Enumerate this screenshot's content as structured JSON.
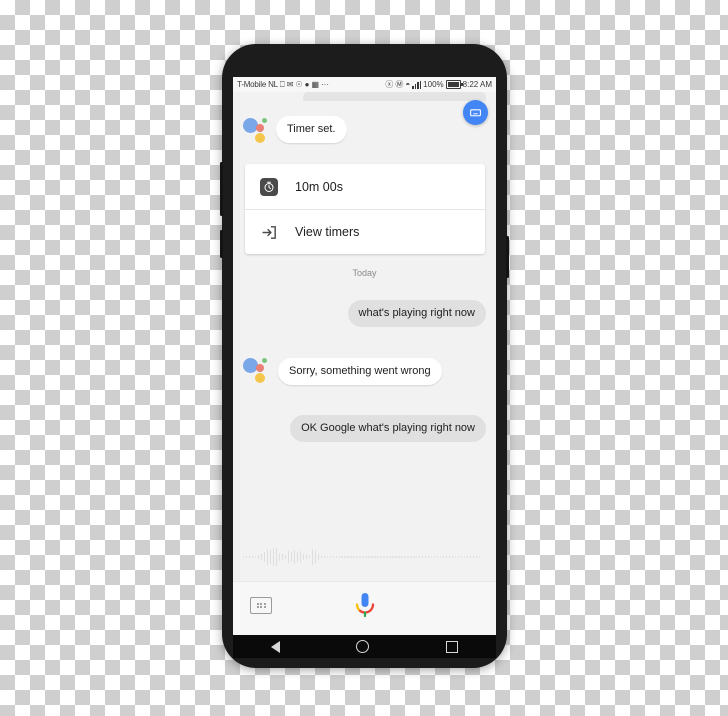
{
  "device": {
    "name": "android-smartphone",
    "frame_color": "#1c1c1c"
  },
  "status_bar": {
    "carrier": "T-Mobile",
    "network": "NL",
    "icons_left": [
      "cast-icon",
      "mail-icon",
      "whatsapp-icon",
      "chat-icon",
      "app-icon",
      "more-overflow-icon"
    ],
    "overflow": "···",
    "icons_right": [
      "location-icon",
      "nfc-icon",
      "wifi-icon",
      "signal-icon"
    ],
    "location_glyph": "ⓧ",
    "nfc_glyph": "N",
    "wifi_glyph": "◠",
    "battery_percent": "100%",
    "time": "8:22 AM"
  },
  "assistant": {
    "keyboard_fab": "keyboard-fab",
    "logo": "google-assistant-dots",
    "reply": "Timer set.",
    "timer_card": {
      "rows": [
        {
          "icon": "clock-icon",
          "label": "10m 00s"
        },
        {
          "icon": "open-timers-icon",
          "label": "View timers"
        }
      ]
    },
    "day_separator": "Today",
    "messages": [
      {
        "from": "user",
        "text": "what's playing right now"
      },
      {
        "from": "assistant",
        "text": "Sorry, something went wrong"
      },
      {
        "from": "user",
        "text": "OK Google what's playing right now"
      }
    ],
    "waveform": {
      "name": "audio-waveform",
      "color": "#dedede",
      "levels": [
        1,
        1,
        1,
        2,
        2,
        3,
        5,
        8,
        12,
        11,
        14,
        13,
        6,
        4,
        3,
        9,
        8,
        10,
        7,
        9,
        5,
        3,
        2,
        12,
        11,
        4,
        2,
        1,
        1,
        1,
        1,
        1,
        1,
        1,
        1,
        1,
        1,
        1,
        1,
        1,
        1,
        1,
        1,
        1,
        1,
        1,
        1,
        1,
        1,
        1,
        1,
        1,
        1,
        1,
        1,
        1,
        1,
        1,
        1,
        1,
        1,
        1,
        1,
        1,
        1,
        1,
        1,
        1,
        1,
        1,
        1,
        1,
        1,
        1,
        1,
        1,
        1,
        1,
        1,
        1
      ]
    }
  },
  "bottom_bar": {
    "keyboard_button": "keyboard-toggle",
    "mic_button": "google-mic"
  },
  "nav_bar": {
    "back": "back-button",
    "home": "home-button",
    "recents": "recents-button"
  },
  "colors": {
    "google_blue": "#4285f4",
    "google_red": "#ea4335",
    "google_yellow": "#fbbc05",
    "google_green": "#34a853",
    "user_bubble": "#e0e0e0",
    "assistant_bubble": "#ffffff",
    "screen_bg": "#f2f2f2"
  }
}
